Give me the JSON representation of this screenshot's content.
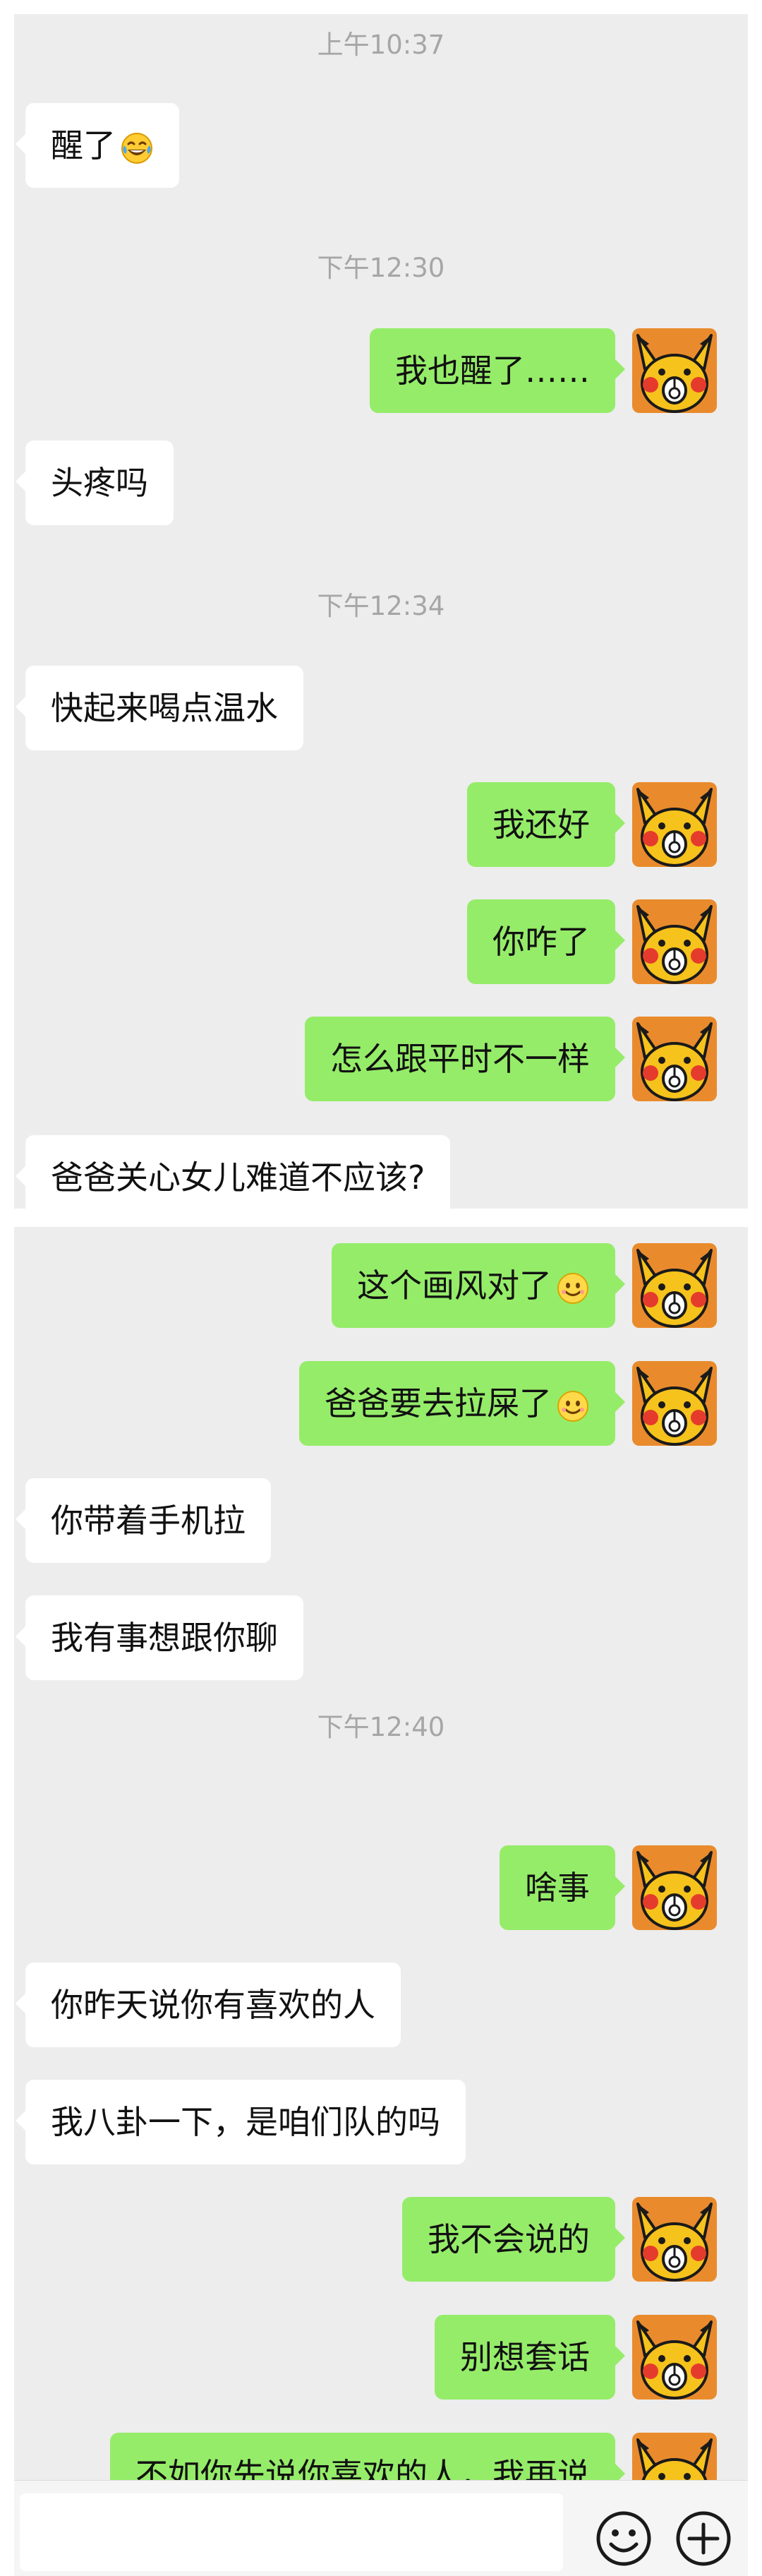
{
  "colors": {
    "panel_bg": "#ededed",
    "sent_bubble": "#95ec69",
    "received_bubble": "#ffffff",
    "timestamp": "#a6a6a6",
    "avatar_bg": "#e98b2c"
  },
  "screen1": {
    "messages": [
      {
        "kind": "time",
        "text": "上午10:37"
      },
      {
        "kind": "in",
        "text": "醒了",
        "emoji": "laugh-cry"
      },
      {
        "kind": "time",
        "text": "下午12:30"
      },
      {
        "kind": "out",
        "text": "我也醒了……"
      },
      {
        "kind": "in",
        "text": "头疼吗"
      },
      {
        "kind": "time",
        "text": "下午12:34"
      },
      {
        "kind": "in",
        "text": "快起来喝点温水"
      },
      {
        "kind": "out",
        "text": "我还好"
      },
      {
        "kind": "out",
        "text": "你咋了"
      },
      {
        "kind": "out",
        "text": "怎么跟平时不一样"
      },
      {
        "kind": "in",
        "text": "爸爸关心女儿难道不应该?"
      }
    ]
  },
  "screen2": {
    "messages": [
      {
        "kind": "out",
        "text": "这个画风对了",
        "emoji": "smile"
      },
      {
        "kind": "out",
        "text": "爸爸要去拉屎了",
        "emoji": "smile"
      },
      {
        "kind": "in",
        "text": "你带着手机拉"
      },
      {
        "kind": "in",
        "text": "我有事想跟你聊"
      },
      {
        "kind": "time",
        "text": "下午12:40"
      },
      {
        "kind": "out",
        "text": "啥事"
      },
      {
        "kind": "in",
        "text": "你昨天说你有喜欢的人"
      },
      {
        "kind": "in",
        "text": "我八卦一下，是咱们队的吗"
      },
      {
        "kind": "out",
        "text": "我不会说的"
      },
      {
        "kind": "out",
        "text": "别想套话"
      },
      {
        "kind": "out",
        "text": "不如你先说你喜欢的人，我再说"
      }
    ]
  },
  "input_bar": {
    "emoji_button_icon": "emoji-face-icon",
    "plus_button_icon": "plus-circle-icon"
  }
}
